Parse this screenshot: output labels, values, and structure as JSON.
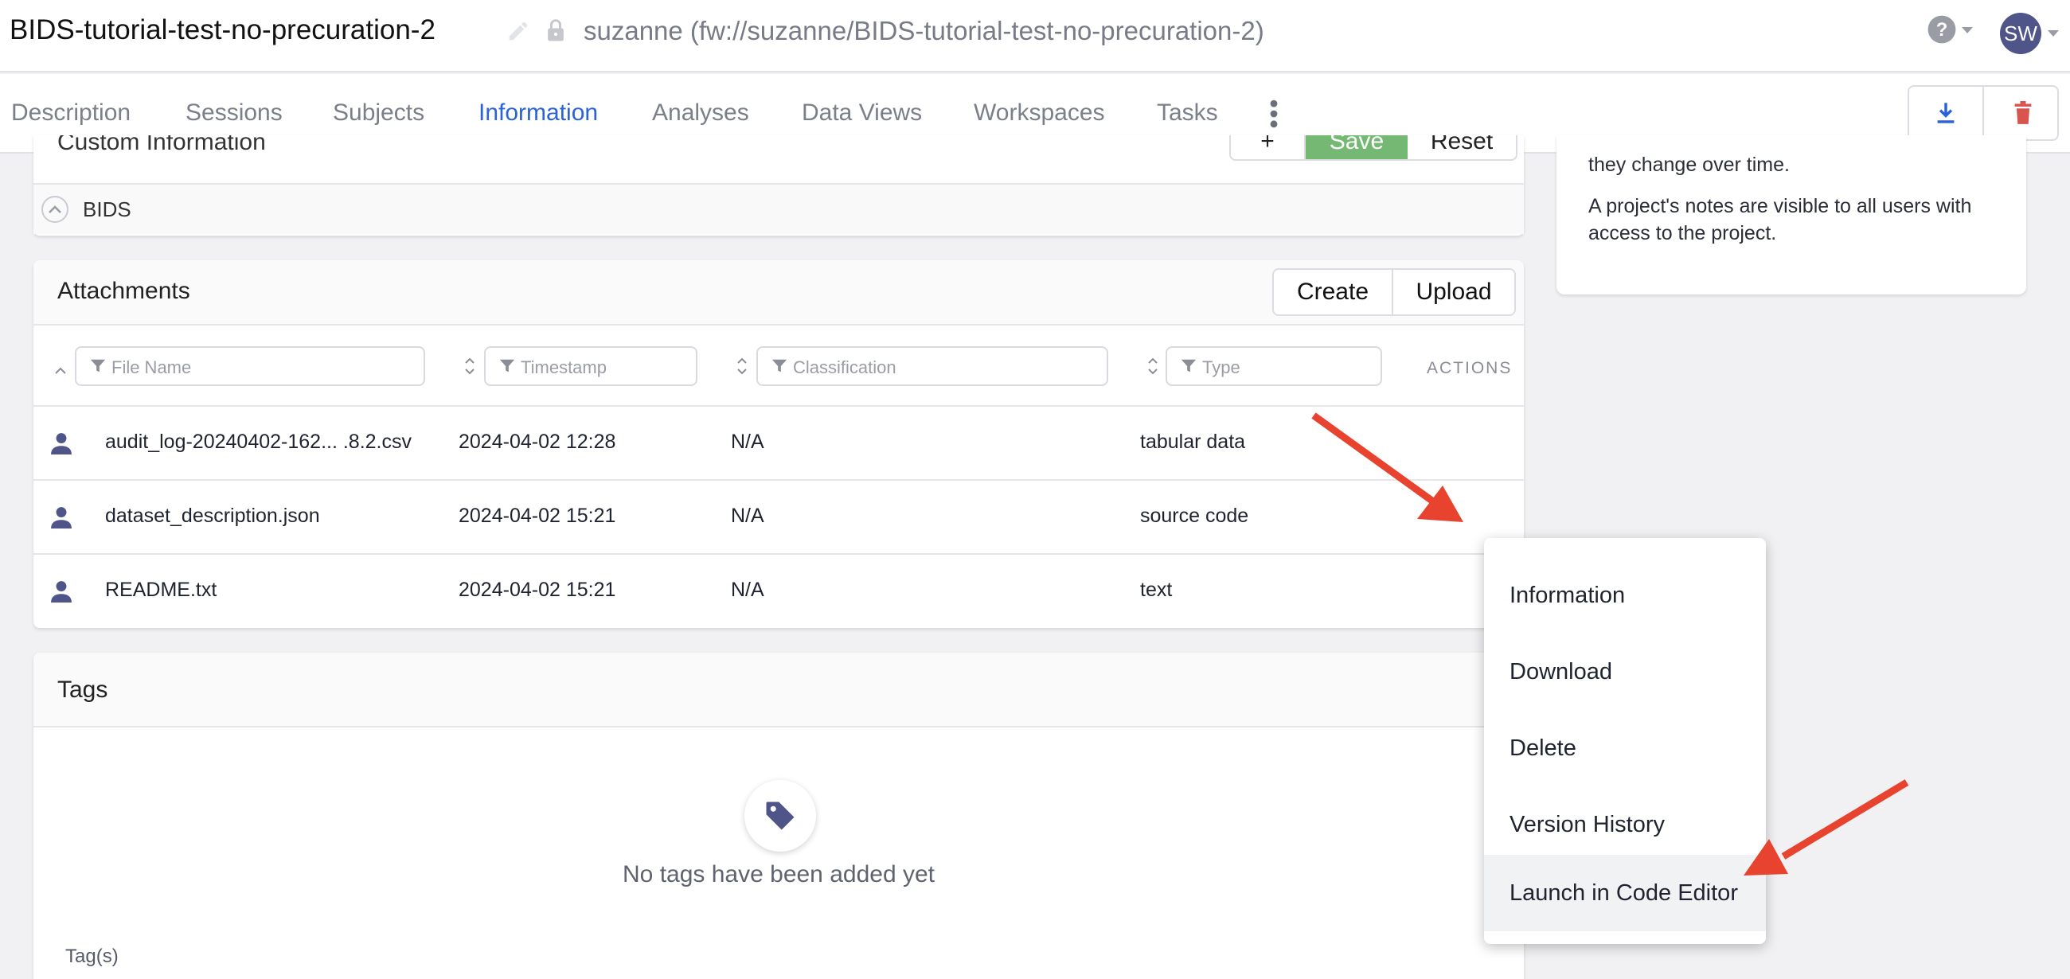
{
  "header": {
    "project_title": "BIDS-tutorial-test-no-precuration-2",
    "project_path": "suzanne (fw://suzanne/BIDS-tutorial-test-no-precuration-2)",
    "avatar_initials": "SW"
  },
  "tabs": [
    {
      "label": "Description"
    },
    {
      "label": "Sessions"
    },
    {
      "label": "Subjects"
    },
    {
      "label": "Information",
      "active": true
    },
    {
      "label": "Analyses"
    },
    {
      "label": "Data Views"
    },
    {
      "label": "Workspaces"
    },
    {
      "label": "Tasks"
    }
  ],
  "custom_info": {
    "title": "Custom Information",
    "buttons": {
      "plus": "+",
      "save": "Save",
      "reset": "Reset"
    },
    "bids_label": "BIDS"
  },
  "notes": {
    "line1": "they change over time.",
    "line2": "A project's notes are visible to all users with access to the project."
  },
  "attachments": {
    "title": "Attachments",
    "create_label": "Create",
    "upload_label": "Upload",
    "filters": {
      "file_name": "File Name",
      "timestamp": "Timestamp",
      "classification": "Classification",
      "type": "Type"
    },
    "actions_header": "ACTIONS",
    "rows": [
      {
        "name": "audit_log-20240402-162...  .8.2.csv",
        "timestamp": "2024-04-02 12:28",
        "classification": "N/A",
        "type": "tabular data"
      },
      {
        "name": "dataset_description.json",
        "timestamp": "2024-04-02 15:21",
        "classification": "N/A",
        "type": "source code"
      },
      {
        "name": "README.txt",
        "timestamp": "2024-04-02 15:21",
        "classification": "N/A",
        "type": "text"
      }
    ]
  },
  "tags": {
    "title": "Tags",
    "empty_message": "No tags have been added yet",
    "tags_label": "Tag(s)"
  },
  "context_menu": {
    "items": [
      {
        "label": "Information"
      },
      {
        "label": "Download"
      },
      {
        "label": "Delete"
      },
      {
        "label": "Version History"
      },
      {
        "label": "Launch in Code Editor",
        "highlighted": true
      }
    ]
  },
  "colors": {
    "accent": "#2a63d8",
    "save_green": "#74b873",
    "delete_red": "#d9534f",
    "annotation_red": "#e8432e",
    "avatar_bg": "#4f5588"
  }
}
